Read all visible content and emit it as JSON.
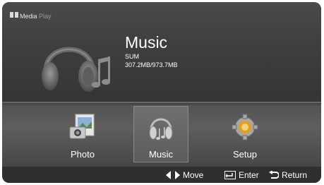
{
  "brand": {
    "word1": "Media",
    "word2": "Play"
  },
  "current": {
    "title": "Music",
    "device": "SUM",
    "usage": "307.2MB/973.7MB"
  },
  "menu": {
    "items": [
      {
        "label": "Photo"
      },
      {
        "label": "Music"
      },
      {
        "label": "Setup"
      }
    ],
    "selected": "Music"
  },
  "hints": {
    "move": "Move",
    "enter": "Enter",
    "return": "Return"
  },
  "icons": [
    "media-play-logo-icon",
    "headphones-music-icon",
    "photo-icon",
    "music-headphones-icon",
    "gear-icon",
    "arrows-icon",
    "enter-icon",
    "return-icon"
  ]
}
